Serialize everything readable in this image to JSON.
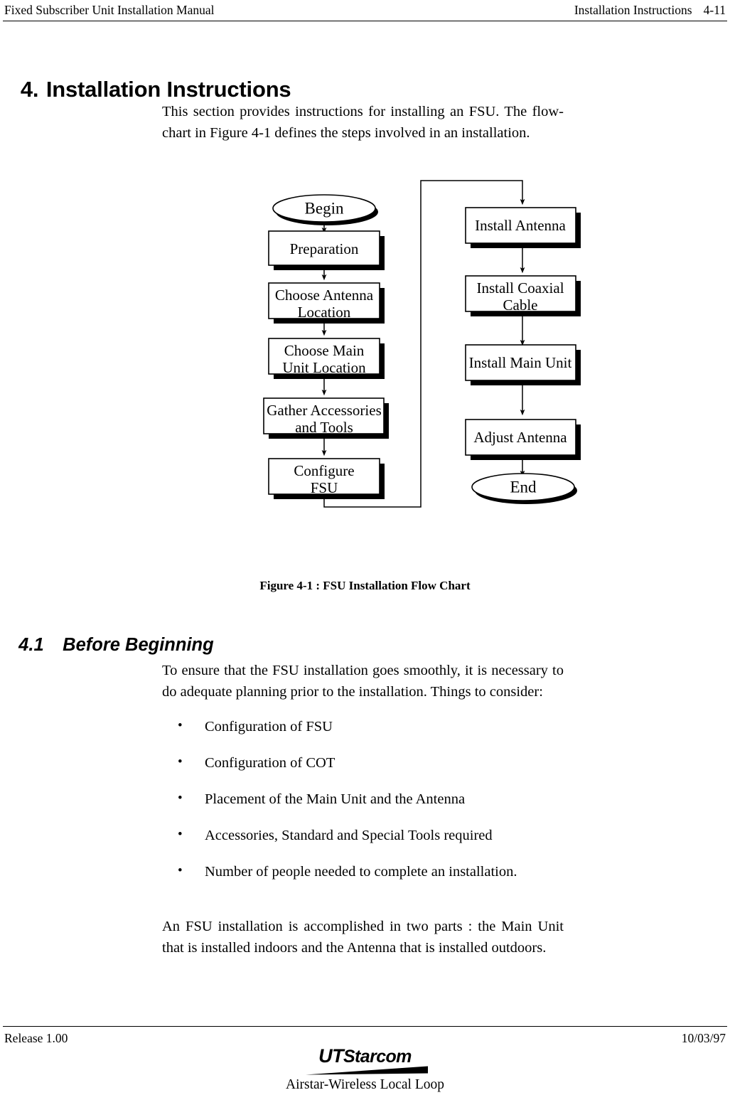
{
  "header": {
    "left_title": "Fixed Subscriber Unit Installation Manual",
    "right_title": "Installation Instructions",
    "page_number": "4-11"
  },
  "section": {
    "number": "4.",
    "title": "Installation Instructions"
  },
  "paragraphs": {
    "intro": "This section provides instructions for installing an FSU.  The flow-chart in Figure 4-1 defines the steps involved in an installation.",
    "ensure": "To ensure that the FSU installation goes smoothly, it is necessary to do adequate planning prior to the installation.  Things to consider:",
    "two_parts": "An FSU installation is accomplished in two parts : the Main Unit that is installed indoors and the Antenna that is installed outdoors."
  },
  "figure": {
    "caption": "Figure 4-1 : FSU Installation Flow Chart"
  },
  "chart_data": {
    "type": "diagram",
    "title": "FSU Installation Flow Chart",
    "nodes": [
      {
        "id": "begin",
        "label": "Begin",
        "shape": "ellipse",
        "column": "left"
      },
      {
        "id": "preparation",
        "label": "Preparation",
        "shape": "rectangle",
        "column": "left"
      },
      {
        "id": "antenna-loc",
        "label": "Choose Antenna Location",
        "shape": "rectangle",
        "column": "left"
      },
      {
        "id": "main-unit-loc",
        "label": "Choose Main Unit Location",
        "shape": "rectangle",
        "column": "left"
      },
      {
        "id": "gather",
        "label": "Gather Accessories and Tools",
        "shape": "rectangle",
        "column": "left"
      },
      {
        "id": "configure",
        "label": "Configure FSU",
        "shape": "rectangle",
        "column": "left"
      },
      {
        "id": "install-ant",
        "label": "Install Antenna",
        "shape": "rectangle",
        "column": "right"
      },
      {
        "id": "install-coax",
        "label": "Install Coaxial Cable",
        "shape": "rectangle",
        "column": "right"
      },
      {
        "id": "install-main",
        "label": "Install Main Unit",
        "shape": "rectangle",
        "column": "right"
      },
      {
        "id": "adjust-ant",
        "label": "Adjust Antenna",
        "shape": "rectangle",
        "column": "right"
      },
      {
        "id": "end",
        "label": "End",
        "shape": "ellipse",
        "column": "right"
      }
    ],
    "edges": [
      {
        "from": "begin",
        "to": "preparation"
      },
      {
        "from": "preparation",
        "to": "antenna-loc"
      },
      {
        "from": "antenna-loc",
        "to": "main-unit-loc"
      },
      {
        "from": "main-unit-loc",
        "to": "gather"
      },
      {
        "from": "gather",
        "to": "configure"
      },
      {
        "from": "configure",
        "to": "install-ant"
      },
      {
        "from": "install-ant",
        "to": "install-coax"
      },
      {
        "from": "install-coax",
        "to": "install-main"
      },
      {
        "from": "install-main",
        "to": "adjust-ant"
      },
      {
        "from": "adjust-ant",
        "to": "end"
      }
    ],
    "node_labels": {
      "begin": "Begin",
      "preparation": "Preparation",
      "antenna_loc_line1": "Choose Antenna",
      "antenna_loc_line2": "Location",
      "main_unit_loc_line1": "Choose Main",
      "main_unit_loc_line2": "Unit Location",
      "gather_line1": "Gather Accessories",
      "gather_line2": "and Tools",
      "configure_line1": "Configure",
      "configure_line2": "FSU",
      "install_antenna": "Install Antenna",
      "install_coax_line1": "Install Coaxial",
      "install_coax_line2": "Cable",
      "install_main_unit": "Install Main Unit",
      "adjust_antenna": "Adjust Antenna",
      "end": "End"
    },
    "colors": {
      "stroke": "#000000",
      "fill": "#ffffff",
      "shadow": "#000000"
    }
  },
  "subsection": {
    "number": "4.1",
    "title": "Before Beginning"
  },
  "bullets": {
    "glyph": "•",
    "items": [
      "Configuration of FSU",
      "Configuration of COT",
      "Placement of the Main Unit and the Antenna",
      "Accessories, Standard and Special Tools required",
      "Number of people needed to complete an installation."
    ]
  },
  "footer": {
    "release": "Release 1.00",
    "date": "10/03/97",
    "logo_ut": "UT",
    "logo_starcom": "Starcom",
    "tagline": "Airstar-Wireless Local Loop"
  }
}
